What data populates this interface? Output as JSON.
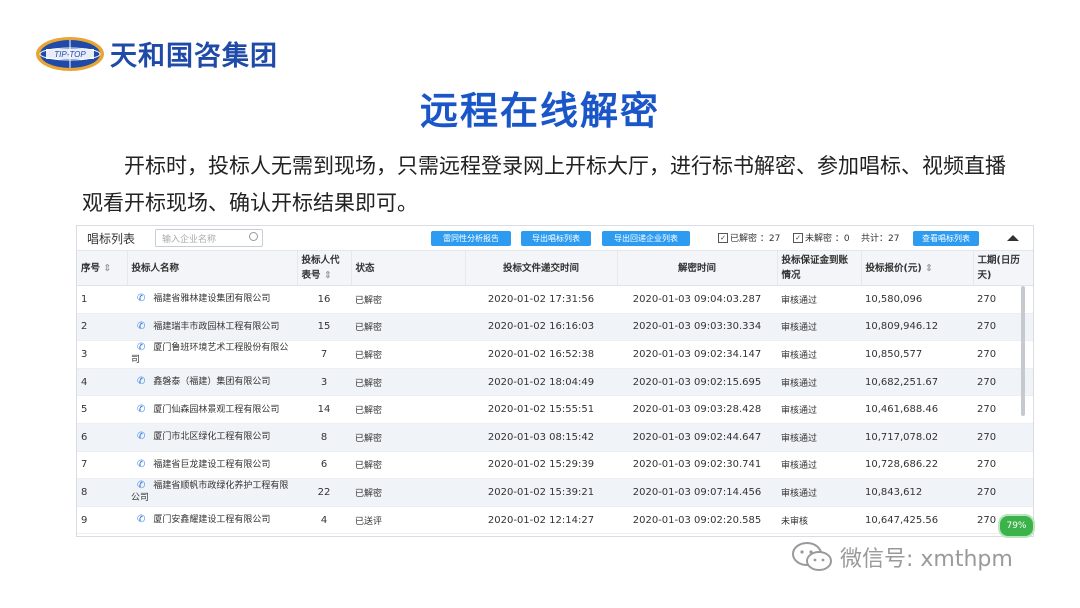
{
  "logo": {
    "badge": "TIP-TOP",
    "name": "天和国咨集团"
  },
  "title": "远程在线解密",
  "intro": "开标时，投标人无需到现场，只需远程登录网上开标大厅，进行标书解密、参加唱标、视频直播观看开标现场、确认开标结果即可。",
  "toolbar": {
    "title": "唱标列表",
    "search_placeholder": "输入企业名称",
    "btn_analysis": "雷同性分析报告",
    "btn_export_list": "导出唱标列表",
    "btn_export_receipt": "导出回递企业列表",
    "decrypted_label": "已解密 ：27",
    "undecrypted_label": "未解密 ：0",
    "total_label": "共计：27",
    "btn_view": "查看唱标列表"
  },
  "table": {
    "headers": [
      "序号",
      "投标人名称",
      "投标人代表号",
      "状态",
      "投标文件递交时间",
      "解密时间",
      "投标保证金到账情况",
      "投标报价(元)",
      "工期(日历天)"
    ],
    "rows": [
      {
        "no": "1",
        "name": "福建省雅林建设集团有限公司",
        "rep": "16",
        "status": "已解密",
        "submit": "2020-01-02 17:31:56",
        "decrypt": "2020-01-03 09:04:03.287",
        "deposit": "审核通过",
        "price": "10,580,096",
        "days": "270"
      },
      {
        "no": "2",
        "name": "福建瑞丰市政园林工程有限公司",
        "rep": "15",
        "status": "已解密",
        "submit": "2020-01-02 16:16:03",
        "decrypt": "2020-01-03 09:03:30.334",
        "deposit": "审核通过",
        "price": "10,809,946.12",
        "days": "270"
      },
      {
        "no": "3",
        "name": "厦门鲁班环境艺术工程股份有限公司",
        "rep": "7",
        "status": "已解密",
        "submit": "2020-01-02 16:52:38",
        "decrypt": "2020-01-03 09:02:34.147",
        "deposit": "审核通过",
        "price": "10,850,577",
        "days": "270"
      },
      {
        "no": "4",
        "name": "鑫磐泰（福建）集团有限公司",
        "rep": "3",
        "status": "已解密",
        "submit": "2020-01-02 18:04:49",
        "decrypt": "2020-01-03 09:02:15.695",
        "deposit": "审核通过",
        "price": "10,682,251.67",
        "days": "270"
      },
      {
        "no": "5",
        "name": "厦门仙森园林景观工程有限公司",
        "rep": "14",
        "status": "已解密",
        "submit": "2020-01-02 15:55:51",
        "decrypt": "2020-01-03 09:03:28.428",
        "deposit": "审核通过",
        "price": "10,461,688.46",
        "days": "270"
      },
      {
        "no": "6",
        "name": "厦门市北区绿化工程有限公司",
        "rep": "8",
        "status": "已解密",
        "submit": "2020-01-03 08:15:42",
        "decrypt": "2020-01-03 09:02:44.647",
        "deposit": "审核通过",
        "price": "10,717,078.02",
        "days": "270"
      },
      {
        "no": "7",
        "name": "福建省巨龙建设工程有限公司",
        "rep": "6",
        "status": "已解密",
        "submit": "2020-01-02 15:29:39",
        "decrypt": "2020-01-03 09:02:30.741",
        "deposit": "审核通过",
        "price": "10,728,686.22",
        "days": "270"
      },
      {
        "no": "8",
        "name": "福建省顺帆市政绿化养护工程有限公司",
        "rep": "22",
        "status": "已解密",
        "submit": "2020-01-02 15:39:21",
        "decrypt": "2020-01-03 09:07:14.456",
        "deposit": "审核通过",
        "price": "10,843,612",
        "days": "270"
      },
      {
        "no": "9",
        "name": "厦门安鑫耀建设工程有限公司",
        "rep": "4",
        "status": "已送评",
        "submit": "2020-01-02 12:14:27",
        "decrypt": "2020-01-03 09:02:20.585",
        "deposit": "未审核",
        "price": "10,647,425.56",
        "days": "270"
      }
    ]
  },
  "badge": "79%",
  "watermark": "微信号: xmthpm",
  "colors": {
    "brand_blue": "#1a56c8",
    "button_blue": "#2d9cf0",
    "badge_green": "#3bb34a"
  }
}
